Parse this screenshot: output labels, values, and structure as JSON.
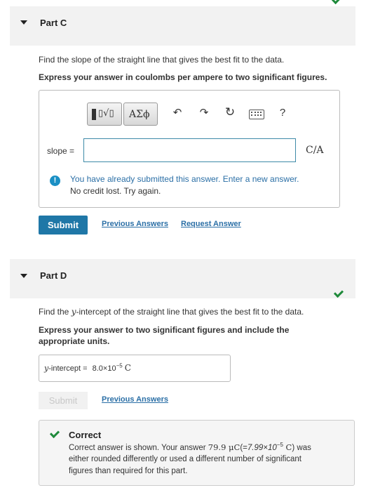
{
  "part_c": {
    "title": "Part C",
    "question": "Find the slope of the straight line that gives the best fit to the data.",
    "instruction": "Express your answer in coulombs per ampere to two significant figures.",
    "toolbar": {
      "templates_label": "▯√▯",
      "greek_label": "ΑΣϕ",
      "help_label": "?"
    },
    "slope_label": "slope =",
    "slope_value": "",
    "unit": "C/A",
    "warning_line1": "You have already submitted this answer. Enter a new answer.",
    "warning_line2": "No credit lost. Try again.",
    "submit_label": "Submit",
    "previous_answers_label": "Previous Answers",
    "request_answer_label": "Request Answer"
  },
  "part_d": {
    "title": "Part D",
    "question_pre": "Find the ",
    "question_var": "y",
    "question_post": "-intercept of the straight line that gives the best fit to the data.",
    "instruction_line1": "Express your answer to two significant figures and include the",
    "instruction_line2": "appropriate units.",
    "answer_var": "y",
    "answer_label": "-intercept = ",
    "answer_mantissa": "8.0×10",
    "answer_exponent": "−5",
    "answer_unit": "C",
    "submit_label": "Submit",
    "previous_answers_label": "Previous Answers",
    "correct_title": "Correct",
    "correct_line1_pre": "Correct answer is shown. Your answer ",
    "correct_value": "79.9 μC",
    "correct_paren_open": "(=",
    "correct_alt_mantissa": "7.99×10",
    "correct_alt_exponent": "−5",
    "correct_alt_unit": " C",
    "correct_paren_close": ")",
    "correct_line1_post": " was",
    "correct_line2": "either rounded differently or used a different number of significant",
    "correct_line3": "figures than required for this part."
  },
  "colors": {
    "accent": "#1f77a7",
    "correct_green": "#1f8a3b",
    "info_blue": "#1a8fc4"
  }
}
